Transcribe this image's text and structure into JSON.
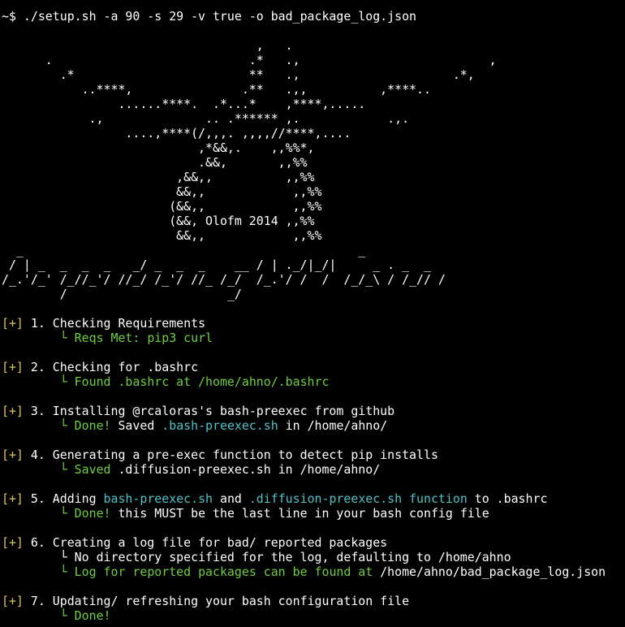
{
  "prompt": {
    "symbol": "~$",
    "command": " ./setup.sh -a 90 -s 29 -v true -o bad_package_log.json"
  },
  "banner": {
    "art_lines": [
      "                                   ,   .",
      "      .                           .*   .,                          ,",
      "        .*                        **   .,                     .*,",
      "           ..****,               .**   .,,          ,****..",
      "                ......****.  .*...*    ,****,.....",
      "            .,              .. .****** ,.            .,.",
      "                 ....,****(/,,,. ,,,,//****,....",
      "                           ,*&&,.    ,,%%*,",
      "                           .&&,       ,,%%",
      "                        ,&&,,          ,,%%",
      "                        &&,,            ,,%%",
      "                       (&&,,            ,,%%",
      "                       (&&, Olofm 2014 ,,%%",
      "                        &&,,            ,,%%",
      "  _                                              _",
      " / | _  _  _  _   _/ _  _  _    __ / | ._/|_/|     _ . _  _",
      "/_.'/_' /_//_'/ //_/ /_'/ //_ /_/  /_.'/ /  /  /_/_\\ / /_// /",
      "        /                      _/"
    ]
  },
  "steps": [
    {
      "marker": "[+]",
      "title": " 1. Checking Requirements",
      "details": [
        {
          "prefix": "└",
          "text": " Reqs Met: pip3 curl"
        }
      ]
    },
    {
      "marker": "[+]",
      "title": " 2. Checking for .bashrc",
      "details": [
        {
          "prefix": "└",
          "text": " Found .bashrc at /home/ahno/.bashrc"
        }
      ]
    },
    {
      "marker": "[+]",
      "title": " 3. Installing @rcaloras's bash-preexec from github",
      "details": [
        {
          "prefix": "└",
          "status": " Done!",
          "plain": " Saved ",
          "file": ".bash-preexec.sh",
          "tail": " in /home/ahno/"
        }
      ]
    },
    {
      "marker": "[+]",
      "title": " 4. Generating a pre-exec function to detect pip installs",
      "details": [
        {
          "prefix": "└",
          "status": " Saved",
          "plain": " .diffusion-preexec.sh in /home/ahno/"
        }
      ]
    },
    {
      "marker": "[+]",
      "title_plain": " 5. Adding ",
      "title_file1": "bash-preexec.sh",
      "title_mid": " and ",
      "title_file2": ".diffusion-preexec.sh",
      "title_fn": " function",
      "title_end": " to .bashrc",
      "details": [
        {
          "prefix": "└",
          "status": " Done!",
          "plain": " this MUST be the last line in your bash config file"
        }
      ]
    },
    {
      "marker": "[+]",
      "title": " 6. Creating a log file for bad/ reported packages",
      "details": [
        {
          "prefix": "└",
          "plain": " No directory specified for the log, defaulting to /home/ahno"
        },
        {
          "prefix": "└",
          "status": " Log for reported packages can be found at",
          "plain": " /home/ahno/bad_package_log.json"
        }
      ]
    },
    {
      "marker": "[+]",
      "title": " 7. Updating/ refreshing your bash configuration file",
      "details": [
        {
          "prefix": "└",
          "status": " Done!"
        }
      ]
    }
  ],
  "colors": {
    "background": "#000000",
    "text": "#ffffff",
    "marker": "#e0c35a",
    "success": "#6fcf3f",
    "path": "#4fc3c8"
  }
}
